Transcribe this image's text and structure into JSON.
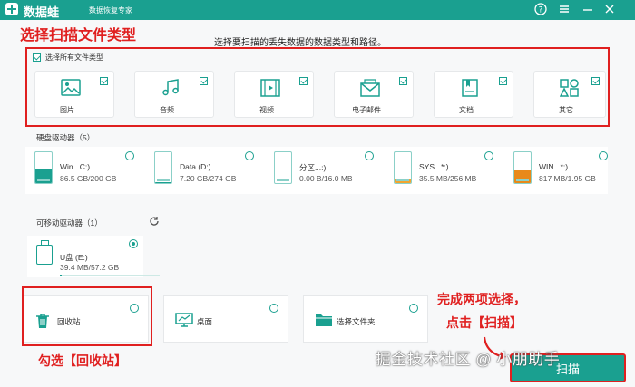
{
  "titlebar": {
    "app_name": "数据蛙",
    "app_sub": "数据恢复专家",
    "accent": "#1aa090"
  },
  "instruction": "选择要扫描的丢失数据的数据类型和路径。",
  "annotations": {
    "title": "选择扫描文件类型",
    "recycle": "勾选【回收站】",
    "scan_line1": "完成两项选择，",
    "scan_line2": "点击【扫描】",
    "color": "#e02020"
  },
  "select_all_label": "选择所有文件类型",
  "file_types": [
    {
      "label": "图片",
      "icon": "image-icon",
      "checked": true
    },
    {
      "label": "音频",
      "icon": "music-icon",
      "checked": true
    },
    {
      "label": "视频",
      "icon": "video-icon",
      "checked": true
    },
    {
      "label": "电子邮件",
      "icon": "email-icon",
      "checked": true
    },
    {
      "label": "文档",
      "icon": "document-icon",
      "checked": true
    },
    {
      "label": "其它",
      "icon": "other-icon",
      "checked": true
    }
  ],
  "hard_drives": {
    "label": "硬盘驱动器（5）",
    "items": [
      {
        "name": "Win...C:)",
        "size": "86.5 GB/200 GB",
        "used_fraction": 0.43,
        "color": "#1aa090"
      },
      {
        "name": "Data (D:)",
        "size": "7.20 GB/274 GB",
        "used_fraction": 0.03,
        "color": "#1aa090"
      },
      {
        "name": "分区...:)",
        "size": "0.00  B/16.0 MB",
        "used_fraction": 0.0,
        "color": "#1aa090"
      },
      {
        "name": "SYS...*:)",
        "size": "35.5 MB/256 MB",
        "used_fraction": 0.14,
        "color": "#f2a531"
      },
      {
        "name": "WIN...*:)",
        "size": "817 MB/1.95 GB",
        "used_fraction": 0.42,
        "color": "#e8891a"
      }
    ]
  },
  "removable_drives": {
    "label": "可移动驱动器（1）",
    "items": [
      {
        "name": "U盘 (E:)",
        "size": "39.4 MB/57.2 GB",
        "used_fraction": 0.01,
        "selected": true
      }
    ]
  },
  "locations": [
    {
      "name": "回收站",
      "icon": "trash-icon"
    },
    {
      "name": "桌面",
      "icon": "desktop-icon"
    },
    {
      "name": "选择文件夹",
      "icon": "folder-icon"
    }
  ],
  "scan_button": "扫描",
  "watermark": "掘金技术社区 @ 小朋助手"
}
